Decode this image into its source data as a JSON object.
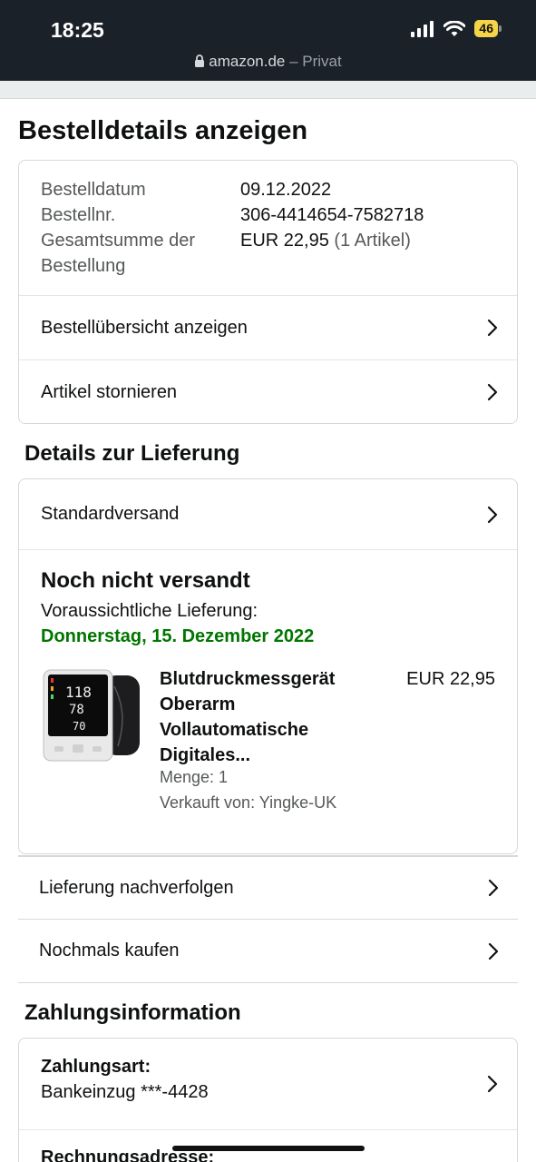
{
  "status_bar": {
    "time": "18:25",
    "battery": "46",
    "url": "amazon.de",
    "url_suffix": " – Privat",
    "icons": [
      "signal-icon",
      "wifi-icon",
      "battery-icon",
      "lock-icon"
    ]
  },
  "page": {
    "title": "Bestelldetails anzeigen"
  },
  "order_info": {
    "date_label": "Bestelldatum",
    "date_value": "09.12.2022",
    "number_label": "Bestellnr.",
    "number_value": "306-4414654-7582718",
    "total_label_line1": "Gesamtsumme der",
    "total_label_line2": "Bestellung",
    "total_value": "EUR 22,95",
    "total_items": "(1 Artikel)",
    "overview_link": "Bestellübersicht anzeigen",
    "cancel_link": "Artikel stornieren"
  },
  "delivery": {
    "section_title": "Details zur Lieferung",
    "shipping_method": "Standardversand",
    "status": "Noch nicht versandt",
    "estimate_label": "Voraussichtliche Lieferung:",
    "estimate_date": "Donnerstag, 15. Dezember 2022",
    "product": {
      "title_lines": [
        "Blutdruckmessgerät",
        "Oberarm",
        "Vollautomatische",
        "Digitales..."
      ],
      "price": "EUR 22,95",
      "quantity": "Menge: 1",
      "seller": "Verkauft von: Yingke-UK"
    },
    "track_link": "Lieferung nachverfolgen",
    "buy_again_link": "Nochmals kaufen"
  },
  "payment": {
    "section_title": "Zahlungsinformation",
    "method_label": "Zahlungsart:",
    "method_value": "Bankeinzug ***-4428",
    "billing_label": "Rechnungsadresse:"
  },
  "colors": {
    "status_bar_bg": "#1b2129",
    "delivery_green": "#007600",
    "battery_yellow": "#f5d547"
  }
}
